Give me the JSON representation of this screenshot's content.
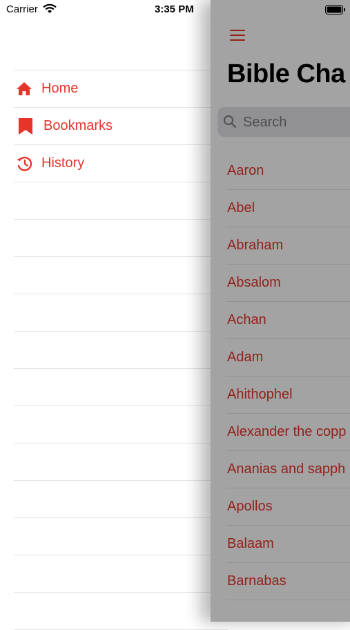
{
  "status_bar": {
    "carrier": "Carrier",
    "time": "3:35 PM",
    "icons": [
      "wifi-icon",
      "battery-icon"
    ]
  },
  "side_menu": {
    "items": [
      {
        "label": "Home",
        "icon": "home-icon"
      },
      {
        "label": "Bookmarks",
        "icon": "bookmark-icon"
      },
      {
        "label": "History",
        "icon": "history-icon"
      }
    ]
  },
  "main": {
    "title": "Bible Cha",
    "search": {
      "placeholder": "Search",
      "value": ""
    },
    "characters": [
      "Aaron",
      "Abel",
      "Abraham",
      "Absalom",
      "Achan",
      "Adam",
      "Ahithophel",
      "Alexander the copp",
      "Ananias and sapph",
      "Apollos",
      "Balaam",
      "Barnabas"
    ]
  },
  "colors": {
    "accent": "#e5352b",
    "separator": "#e4e4e6",
    "overlay": "rgba(0,0,0,0.36)"
  }
}
